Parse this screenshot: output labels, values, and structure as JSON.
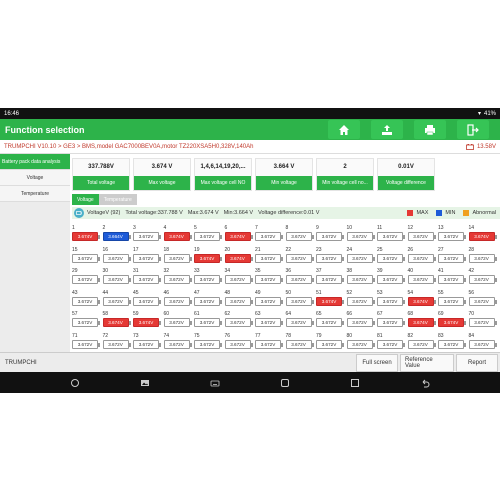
{
  "status": {
    "time": "16:46",
    "battery": "41%"
  },
  "appbar": {
    "title": "Function selection",
    "icons": [
      "home-icon",
      "upload-icon",
      "print-icon",
      "exit-icon"
    ]
  },
  "breadcrumb": {
    "path": "TRUMPCHI V10.10 > GE3 > BMS,model GAC7000BEV0A,motor TZ220XSA5H0,328V,140Ah",
    "voltage": "13.58V"
  },
  "sidebar": {
    "items": [
      "Battery pack data analysis",
      "Voltage",
      "Temperature"
    ]
  },
  "cards": [
    {
      "value": "337.788V",
      "label": "Total voltage"
    },
    {
      "value": "3.674 V",
      "label": "Max voltage"
    },
    {
      "value": "1,4,6,14,19,20,...",
      "label": "Max voltage cell NO"
    },
    {
      "value": "3.664 V",
      "label": "Min voltage"
    },
    {
      "value": "2",
      "label": "Min voltage cell no..."
    },
    {
      "value": "0.01V",
      "label": "Voltage difference"
    }
  ],
  "tabs": [
    "Voltage",
    "Temperature"
  ],
  "summary": {
    "name": "VoltageV (92)",
    "total": "Total voltage:337.788 V",
    "max": "Max:3.674 V",
    "min": "Min:3.664 V",
    "diff": "Voltage difference:0.01 V"
  },
  "legend": [
    {
      "label": "MAX",
      "color": "#e53935"
    },
    {
      "label": "MIN",
      "color": "#1e5bd8"
    },
    {
      "label": "Abnormal",
      "color": "#f0a020"
    }
  ],
  "cells": [
    {
      "n": "1",
      "v": "3.674V",
      "s": "max"
    },
    {
      "n": "2",
      "v": "3.664V",
      "s": "min"
    },
    {
      "n": "3",
      "v": "3.672V",
      "s": ""
    },
    {
      "n": "4",
      "v": "3.674V",
      "s": "max"
    },
    {
      "n": "5",
      "v": "3.672V",
      "s": ""
    },
    {
      "n": "6",
      "v": "3.674V",
      "s": "max"
    },
    {
      "n": "7",
      "v": "3.672V",
      "s": ""
    },
    {
      "n": "8",
      "v": "3.672V",
      "s": ""
    },
    {
      "n": "9",
      "v": "3.672V",
      "s": ""
    },
    {
      "n": "10",
      "v": "3.672V",
      "s": ""
    },
    {
      "n": "11",
      "v": "3.672V",
      "s": ""
    },
    {
      "n": "12",
      "v": "3.672V",
      "s": ""
    },
    {
      "n": "13",
      "v": "3.672V",
      "s": ""
    },
    {
      "n": "14",
      "v": "3.674V",
      "s": "max"
    },
    {
      "n": "15",
      "v": "3.672V",
      "s": ""
    },
    {
      "n": "16",
      "v": "3.672V",
      "s": ""
    },
    {
      "n": "17",
      "v": "3.672V",
      "s": ""
    },
    {
      "n": "18",
      "v": "3.672V",
      "s": ""
    },
    {
      "n": "19",
      "v": "3.674V",
      "s": "max"
    },
    {
      "n": "20",
      "v": "3.674V",
      "s": "max"
    },
    {
      "n": "21",
      "v": "3.672V",
      "s": ""
    },
    {
      "n": "22",
      "v": "3.672V",
      "s": ""
    },
    {
      "n": "23",
      "v": "3.672V",
      "s": ""
    },
    {
      "n": "24",
      "v": "3.672V",
      "s": ""
    },
    {
      "n": "25",
      "v": "3.672V",
      "s": ""
    },
    {
      "n": "26",
      "v": "3.672V",
      "s": ""
    },
    {
      "n": "27",
      "v": "3.672V",
      "s": ""
    },
    {
      "n": "28",
      "v": "3.672V",
      "s": ""
    },
    {
      "n": "29",
      "v": "3.672V",
      "s": ""
    },
    {
      "n": "30",
      "v": "3.672V",
      "s": ""
    },
    {
      "n": "31",
      "v": "3.672V",
      "s": ""
    },
    {
      "n": "32",
      "v": "3.672V",
      "s": ""
    },
    {
      "n": "33",
      "v": "3.672V",
      "s": ""
    },
    {
      "n": "34",
      "v": "3.672V",
      "s": ""
    },
    {
      "n": "35",
      "v": "3.672V",
      "s": ""
    },
    {
      "n": "36",
      "v": "3.672V",
      "s": ""
    },
    {
      "n": "37",
      "v": "3.672V",
      "s": ""
    },
    {
      "n": "38",
      "v": "3.672V",
      "s": ""
    },
    {
      "n": "39",
      "v": "3.672V",
      "s": ""
    },
    {
      "n": "40",
      "v": "3.672V",
      "s": ""
    },
    {
      "n": "41",
      "v": "3.672V",
      "s": ""
    },
    {
      "n": "42",
      "v": "3.672V",
      "s": ""
    },
    {
      "n": "43",
      "v": "3.672V",
      "s": ""
    },
    {
      "n": "44",
      "v": "3.672V",
      "s": ""
    },
    {
      "n": "45",
      "v": "3.672V",
      "s": ""
    },
    {
      "n": "46",
      "v": "3.672V",
      "s": ""
    },
    {
      "n": "47",
      "v": "3.672V",
      "s": ""
    },
    {
      "n": "48",
      "v": "3.672V",
      "s": ""
    },
    {
      "n": "49",
      "v": "3.672V",
      "s": ""
    },
    {
      "n": "50",
      "v": "3.672V",
      "s": ""
    },
    {
      "n": "51",
      "v": "3.674V",
      "s": "max"
    },
    {
      "n": "52",
      "v": "3.672V",
      "s": ""
    },
    {
      "n": "53",
      "v": "3.672V",
      "s": ""
    },
    {
      "n": "54",
      "v": "3.674V",
      "s": "max"
    },
    {
      "n": "55",
      "v": "3.672V",
      "s": ""
    },
    {
      "n": "56",
      "v": "3.672V",
      "s": ""
    },
    {
      "n": "57",
      "v": "3.672V",
      "s": ""
    },
    {
      "n": "58",
      "v": "3.674V",
      "s": "max"
    },
    {
      "n": "59",
      "v": "3.674V",
      "s": "max"
    },
    {
      "n": "60",
      "v": "3.672V",
      "s": ""
    },
    {
      "n": "61",
      "v": "3.672V",
      "s": ""
    },
    {
      "n": "62",
      "v": "3.672V",
      "s": ""
    },
    {
      "n": "63",
      "v": "3.672V",
      "s": ""
    },
    {
      "n": "64",
      "v": "3.672V",
      "s": ""
    },
    {
      "n": "65",
      "v": "3.672V",
      "s": ""
    },
    {
      "n": "66",
      "v": "3.672V",
      "s": ""
    },
    {
      "n": "67",
      "v": "3.672V",
      "s": ""
    },
    {
      "n": "68",
      "v": "3.674V",
      "s": "max"
    },
    {
      "n": "69",
      "v": "3.674V",
      "s": "max"
    },
    {
      "n": "70",
      "v": "3.672V",
      "s": ""
    },
    {
      "n": "71",
      "v": "3.672V",
      "s": ""
    },
    {
      "n": "72",
      "v": "3.672V",
      "s": ""
    },
    {
      "n": "73",
      "v": "3.672V",
      "s": ""
    },
    {
      "n": "74",
      "v": "3.672V",
      "s": ""
    },
    {
      "n": "75",
      "v": "3.672V",
      "s": ""
    },
    {
      "n": "76",
      "v": "3.672V",
      "s": ""
    },
    {
      "n": "77",
      "v": "3.672V",
      "s": ""
    },
    {
      "n": "78",
      "v": "3.672V",
      "s": ""
    },
    {
      "n": "79",
      "v": "3.672V",
      "s": ""
    },
    {
      "n": "80",
      "v": "3.672V",
      "s": ""
    },
    {
      "n": "81",
      "v": "3.672V",
      "s": ""
    },
    {
      "n": "82",
      "v": "3.672V",
      "s": ""
    },
    {
      "n": "83",
      "v": "3.672V",
      "s": ""
    },
    {
      "n": "84",
      "v": "3.672V",
      "s": ""
    }
  ],
  "bottombar": {
    "brand": "TRUMPCHI",
    "buttons": [
      "Full screen",
      "Reference Value",
      "Report"
    ]
  },
  "navbar": {
    "icons": [
      "circle-icon",
      "gallery-icon",
      "keyboard-icon",
      "home-icon",
      "recent-apps-icon",
      "back-icon"
    ]
  }
}
